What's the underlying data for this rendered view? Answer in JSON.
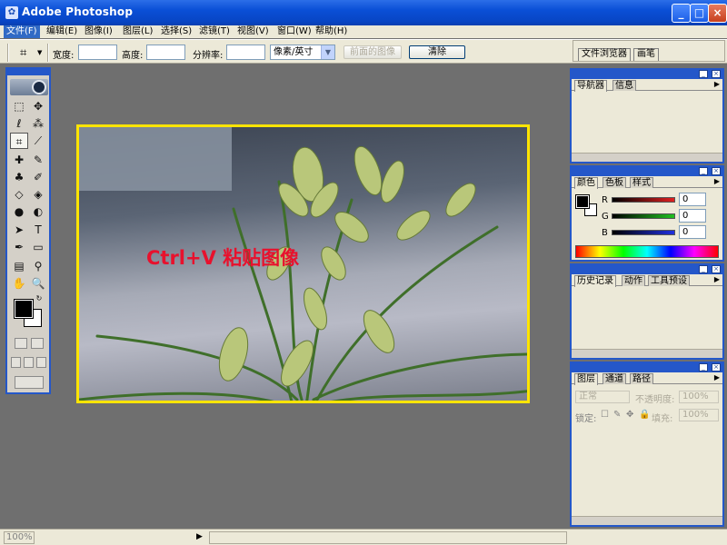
{
  "window": {
    "title": "Adobe Photoshop",
    "app_icon": "photoshop-icon",
    "controls": [
      "_",
      "□",
      "×"
    ]
  },
  "menu": [
    "文件(F)",
    "编辑(E)",
    "图像(I)",
    "图层(L)",
    "选择(S)",
    "滤镜(T)",
    "视图(V)",
    "窗口(W)",
    "帮助(H)"
  ],
  "options": {
    "tool_icon": "crop-icon",
    "width_label": "宽度:",
    "height_label": "高度:",
    "resolution_label": "分辨率:",
    "unit_select": "像素/英寸",
    "front_image_button": "前面的图像",
    "clear_button": "清除"
  },
  "palette_well": [
    "文件浏览器",
    "画笔"
  ],
  "document": {
    "caption": "Ctrl+V  粘贴图像"
  },
  "panels": {
    "navigator": {
      "tabs": [
        "导航器",
        "信息"
      ]
    },
    "color": {
      "tabs": [
        "颜色",
        "色板",
        "样式"
      ],
      "channels": [
        {
          "label": "R",
          "value": "0",
          "color": "#e02020"
        },
        {
          "label": "G",
          "value": "0",
          "color": "#20c020"
        },
        {
          "label": "B",
          "value": "0",
          "color": "#2030e0"
        }
      ]
    },
    "history": {
      "tabs": [
        "历史记录",
        "动作",
        "工具预设"
      ]
    },
    "layers": {
      "tabs": [
        "图层",
        "通道",
        "路径"
      ],
      "blend_mode": "正常",
      "opacity_label": "不透明度:",
      "opacity_value": "100%",
      "lock_label": "锁定:",
      "fill_label": "填充:",
      "fill_value": "100%"
    }
  },
  "status": {
    "zoom": "100%"
  }
}
